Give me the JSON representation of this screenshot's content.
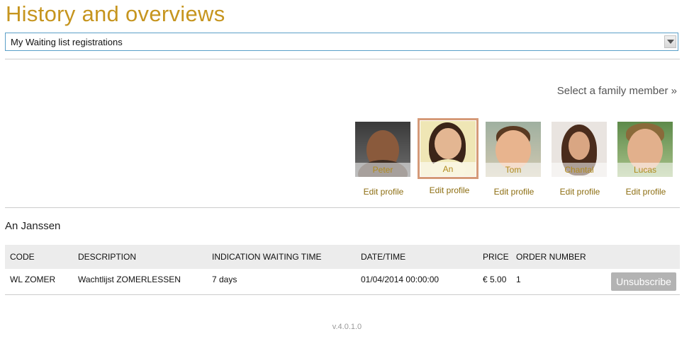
{
  "page": {
    "title": "History and overviews",
    "version": "v.4.0.1.0"
  },
  "overview_select": {
    "selected": "My Waiting list registrations"
  },
  "family": {
    "select_label": "Select a family member »",
    "edit_label": "Edit profile",
    "members": [
      {
        "name": "Peter",
        "selected": false
      },
      {
        "name": "An",
        "selected": true
      },
      {
        "name": "Tom",
        "selected": false
      },
      {
        "name": "Chantal",
        "selected": false
      },
      {
        "name": "Lucas",
        "selected": false
      }
    ]
  },
  "selected_person": {
    "name": "An Janssen"
  },
  "table": {
    "headers": [
      "CODE",
      "DESCRIPTION",
      "INDICATION WAITING TIME",
      "DATE/TIME",
      "PRICE",
      "ORDER NUMBER"
    ],
    "rows": [
      {
        "code": "WL ZOMER",
        "description": "Wachtlijst ZOMERLESSEN",
        "waiting_time": "7 days",
        "datetime": "01/04/2014 00:00:00",
        "price": "€ 5.00",
        "order_number": "1",
        "action": "Unsubscribe"
      }
    ]
  }
}
